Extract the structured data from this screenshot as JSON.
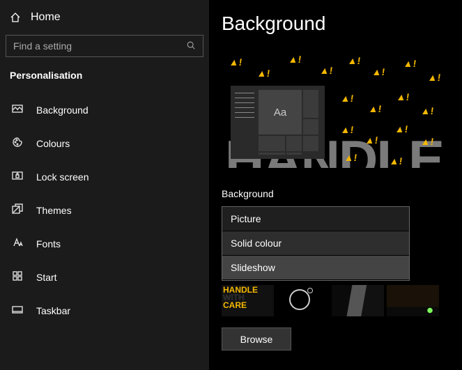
{
  "sidebar": {
    "home": "Home",
    "search_placeholder": "Find a setting",
    "section": "Personalisation",
    "items": [
      {
        "icon": "background-icon",
        "label": "Background"
      },
      {
        "icon": "colours-icon",
        "label": "Colours"
      },
      {
        "icon": "lockscreen-icon",
        "label": "Lock screen"
      },
      {
        "icon": "themes-icon",
        "label": "Themes"
      },
      {
        "icon": "fonts-icon",
        "label": "Fonts"
      },
      {
        "icon": "start-icon",
        "label": "Start"
      },
      {
        "icon": "taskbar-icon",
        "label": "Taskbar"
      }
    ]
  },
  "content": {
    "title": "Background",
    "preview_sample_text": "Aa",
    "label": "Background",
    "options": [
      "Picture",
      "Solid colour",
      "Slideshow"
    ],
    "selected_option": "Slideshow",
    "browse": "Browse"
  },
  "annotation": {
    "arrow_target": "Slideshow"
  }
}
